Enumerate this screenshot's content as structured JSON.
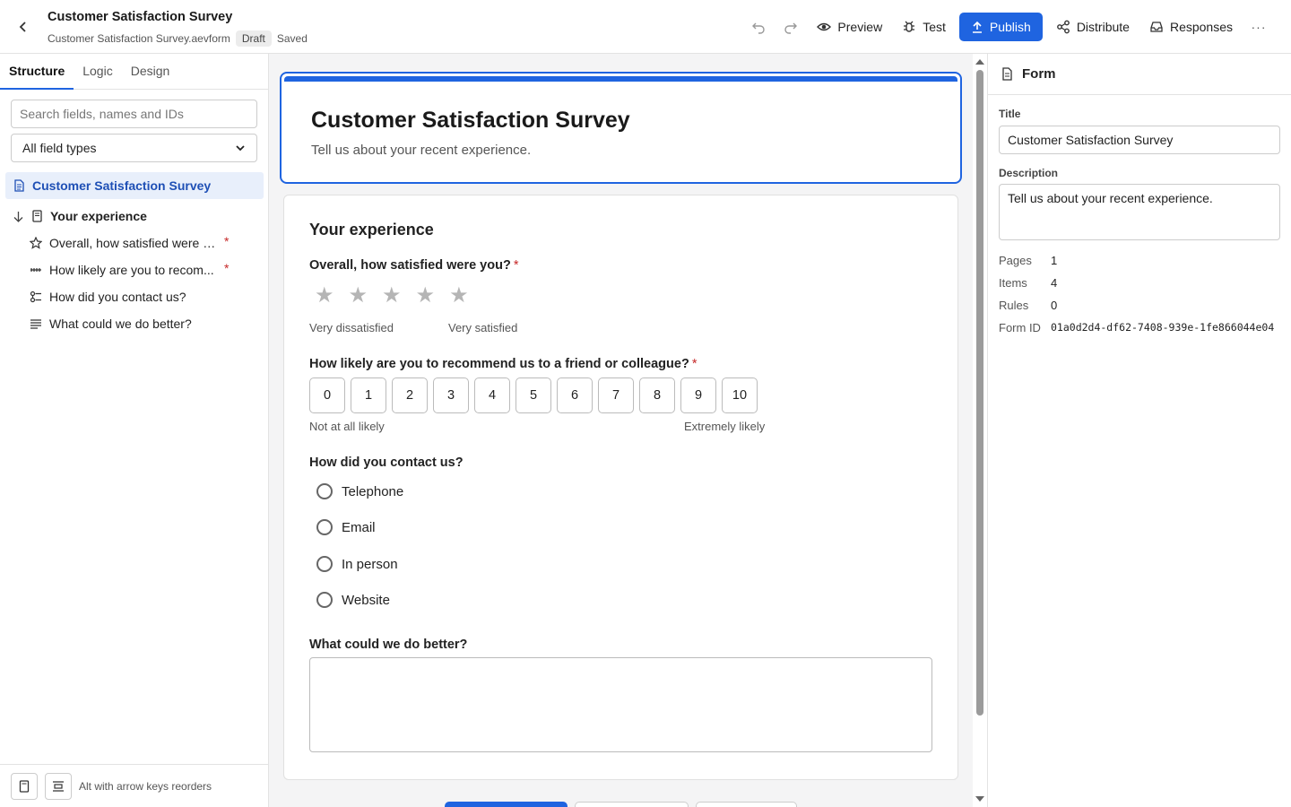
{
  "header": {
    "title": "Customer Satisfaction Survey",
    "filename": "Customer Satisfaction Survey.aevform",
    "status_badge": "Draft",
    "save_status": "Saved",
    "actions": {
      "preview": "Preview",
      "test": "Test",
      "publish": "Publish",
      "distribute": "Distribute",
      "responses": "Responses",
      "more": "···"
    }
  },
  "sidebar": {
    "tabs": [
      "Structure",
      "Logic",
      "Design"
    ],
    "search_placeholder": "Search fields, names and IDs",
    "filter_value": "All field types",
    "root": "Customer Satisfaction Survey",
    "group": "Your experience",
    "items": [
      {
        "label": "Overall, how satisfied were y...",
        "icon": "star-icon",
        "required": "*"
      },
      {
        "label": "How likely are you to recom...",
        "icon": "scale-icon",
        "required": "*"
      },
      {
        "label": "How did you contact us?",
        "icon": "choice-icon",
        "required": ""
      },
      {
        "label": "What could we do better?",
        "icon": "text-lines-icon",
        "required": ""
      }
    ],
    "footer_hint": "Alt with arrow keys reorders"
  },
  "form": {
    "title": "Customer Satisfaction Survey",
    "description": "Tell us about your recent experience.",
    "section_title": "Your experience",
    "q1": {
      "label": "Overall, how satisfied were you?",
      "required": "*",
      "stars": 5,
      "low_hint": "Very dissatisfied",
      "high_hint": "Very satisfied"
    },
    "q2": {
      "label": "How likely are you to recommend us to a friend or colleague?",
      "required": "*",
      "scale": [
        "0",
        "1",
        "2",
        "3",
        "4",
        "5",
        "6",
        "7",
        "8",
        "9",
        "10"
      ],
      "low_hint": "Not at all likely",
      "high_hint": "Extremely likely"
    },
    "q3": {
      "label": "How did you contact us?",
      "options": [
        "Telephone",
        "Email",
        "In person",
        "Website"
      ]
    },
    "q4": {
      "label": "What could we do better?",
      "value": ""
    }
  },
  "properties": {
    "heading": "Form",
    "title_label": "Title",
    "title_value": "Customer Satisfaction Survey",
    "description_label": "Description",
    "description_value": "Tell us about your recent experience.",
    "pages_label": "Pages",
    "pages": "1",
    "items_label": "Items",
    "items": "4",
    "rules_label": "Rules",
    "rules": "0",
    "formid_label": "Form ID",
    "formid": "01a0d2d4-df62-7408-939e-1fe866044e04"
  },
  "colors": {
    "accent": "#1f64e0",
    "required": "#c62828"
  }
}
